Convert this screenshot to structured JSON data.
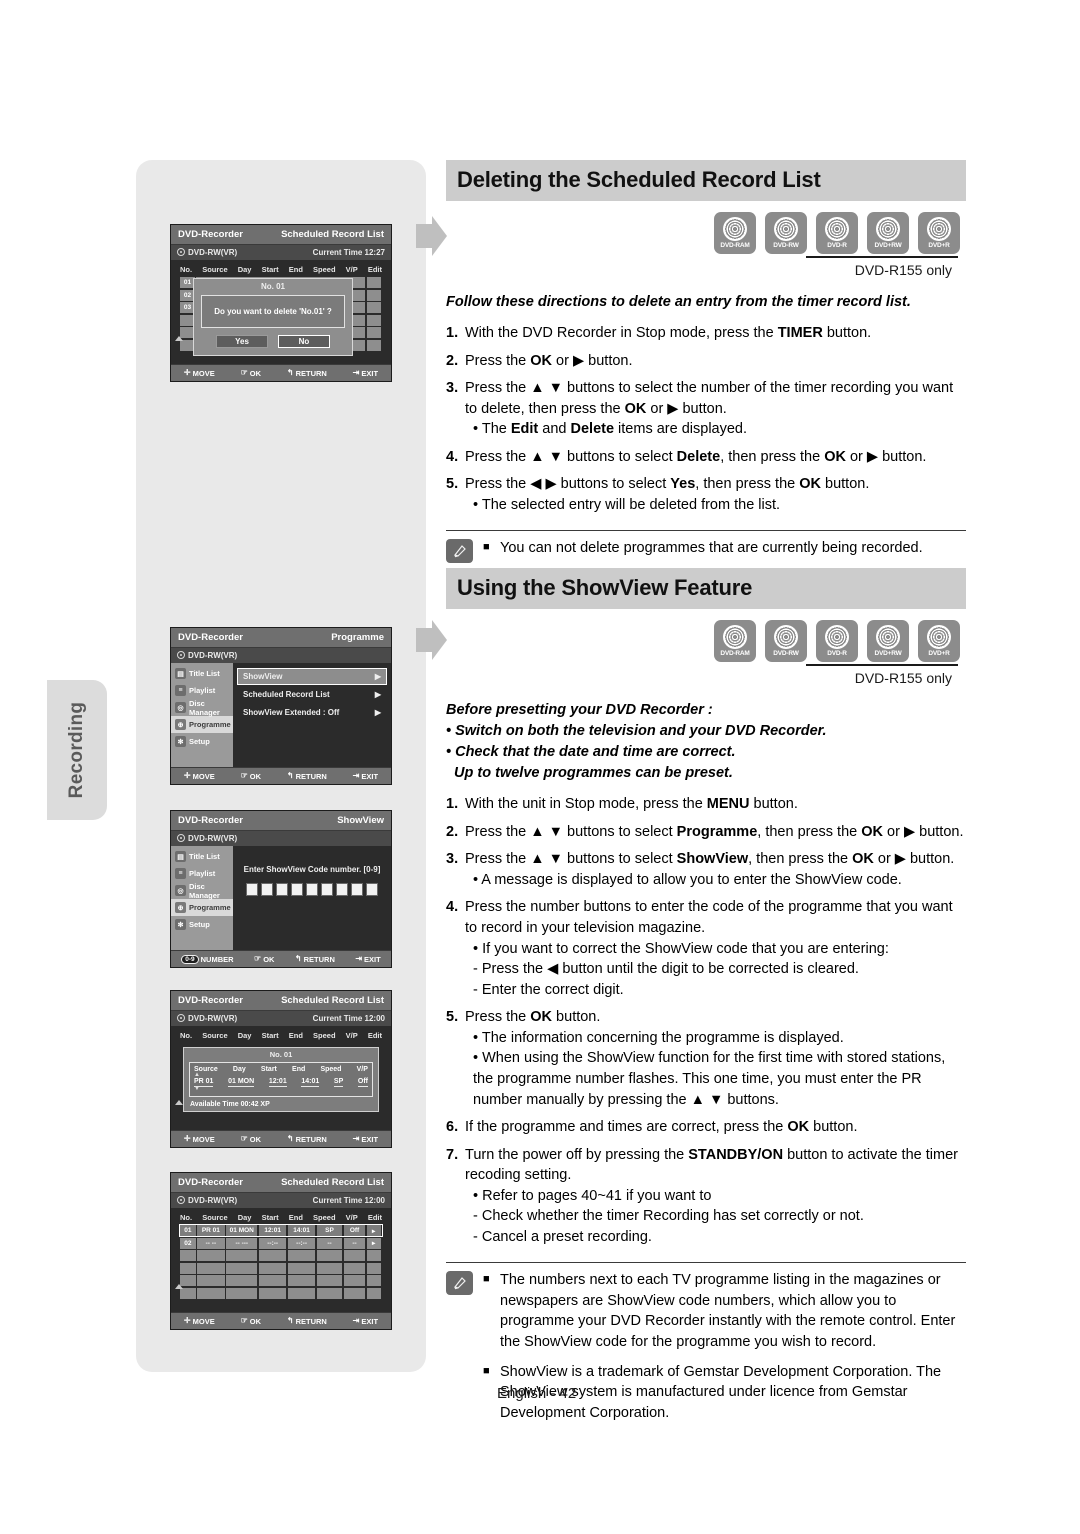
{
  "side_tab": {
    "label": "Recording"
  },
  "footer": {
    "page_label": "English - 42"
  },
  "sections": [
    {
      "heading": "Deleting the Scheduled Record List",
      "discs": [
        "DVD-RAM",
        "DVD-RW",
        "DVD-R",
        "DVD+RW",
        "DVD+R"
      ],
      "only_note": "DVD-R155 only",
      "lead": "Follow these directions to delete an entry from the timer record list.",
      "lead_sub": [],
      "steps": [
        {
          "num": "1.",
          "text": "With the DVD Recorder in Stop mode, press the <b>TIMER</b> button.",
          "sub": []
        },
        {
          "num": "2.",
          "text": "Press the <b>OK</b> or ▶ button.",
          "sub": []
        },
        {
          "num": "3.",
          "text": "Press the ▲ ▼ buttons to select the number of the timer recording you want to delete, then press the <b>OK</b> or ▶ button.",
          "sub": [
            "• The <b>Edit</b> and <b>Delete</b> items are displayed."
          ]
        },
        {
          "num": "4.",
          "text": "Press the ▲ ▼ buttons to select <b>Delete</b>, then press the <b>OK</b> or ▶ button.",
          "sub": []
        },
        {
          "num": "5.",
          "text": "Press the ◀ ▶ buttons to select <b>Yes</b>, then press the <b>OK</b> button.",
          "sub": [
            "• The selected entry will be deleted from the list."
          ]
        }
      ],
      "notes": [
        "You can not delete programmes that are currently being recorded."
      ]
    },
    {
      "heading": "Using the ShowView Feature",
      "discs": [
        "DVD-RAM",
        "DVD-RW",
        "DVD-R",
        "DVD+RW",
        "DVD+R"
      ],
      "only_note": "DVD-R155 only",
      "lead": "Before presetting your DVD Recorder :",
      "lead_sub": [
        "• Switch on both the television and your DVD Recorder.",
        "• Check that the date and time are correct.",
        "  Up to twelve programmes can be preset."
      ],
      "steps": [
        {
          "num": "1.",
          "text": "With the unit in Stop mode, press the <b>MENU</b> button.",
          "sub": []
        },
        {
          "num": "2.",
          "text": "Press the ▲ ▼ buttons to select <b>Programme</b>, then press the <b>OK</b> or ▶ button.",
          "sub": []
        },
        {
          "num": "3.",
          "text": "Press the ▲ ▼ buttons to select <b>ShowView</b>, then press the <b>OK</b> or ▶ button.",
          "sub": [
            "• A message is displayed to allow you to enter the ShowView code."
          ]
        },
        {
          "num": "4.",
          "text": "Press the number buttons to enter the code of the programme that you want to record in your television magazine.",
          "sub": [
            "• If you want to correct the ShowView code that you are entering:",
            "- Press the ◀ button until the digit to be corrected is cleared.",
            "- Enter the correct digit."
          ]
        },
        {
          "num": "5.",
          "text": "Press the <b>OK</b> button.",
          "sub": [
            "• The information concerning the programme is displayed.",
            "• When using the ShowView function for the first time with stored stations, the programme number flashes. This one time, you must enter the PR number manually by pressing the ▲ ▼ buttons."
          ]
        },
        {
          "num": "6.",
          "text": "If the programme and times are correct, press the <b>OK</b> button.",
          "sub": []
        },
        {
          "num": "7.",
          "text": "Turn the power off by pressing the <b>STANDBY/ON</b> button to activate the timer recoding setting.",
          "sub": [
            "• Refer to pages 40~41 if you want to",
            "- Check whether the timer Recording has set correctly or not.",
            "- Cancel a preset recording."
          ]
        }
      ],
      "notes": [
        "The numbers next to each TV programme listing in the magazines or newspapers are ShowView code numbers, which allow you to programme your DVD Recorder instantly with the remote control. Enter the ShowView code for the programme you wish to record.",
        "ShowView is a trademark of Gemstar Development Corporation. The ShowView system is manufactured under licence from Gemstar Development Corporation."
      ]
    }
  ],
  "screens": {
    "footer_hints": {
      "move": "MOVE",
      "ok": "OK",
      "return": "RETURN",
      "exit": "EXIT",
      "number": "NUMBER",
      "number_badge": "0-9"
    },
    "s1": {
      "title_left": "DVD-Recorder",
      "title_right": "Scheduled Record List",
      "disc_label": "DVD-RW(VR)",
      "time_label": "Current Time  12:27",
      "columns": [
        "No.",
        "Source",
        "Day",
        "Start",
        "End",
        "Speed",
        "V/P",
        "Edit"
      ],
      "rows": [
        "01",
        "02",
        "03"
      ],
      "dialog": {
        "header": "No. 01",
        "message": "Do you want to delete 'No.01' ?",
        "yes": "Yes",
        "no": "No"
      }
    },
    "s2": {
      "title_left": "DVD-Recorder",
      "title_right": "Programme",
      "disc_label": "DVD-RW(VR)",
      "sidebar": [
        "Title List",
        "Playlist",
        "Disc Manager",
        "Programme",
        "Setup"
      ],
      "sidebar_active": "Programme",
      "items": [
        "ShowView",
        "Scheduled Record List",
        "ShowView Extended : Off"
      ],
      "item_selected": "ShowView"
    },
    "s3": {
      "title_left": "DVD-Recorder",
      "title_right": "ShowView",
      "disc_label": "DVD-RW(VR)",
      "sidebar": [
        "Title List",
        "Playlist",
        "Disc Manager",
        "Programme",
        "Setup"
      ],
      "sidebar_active": "Programme",
      "prompt": "Enter ShowView Code number. [0-9]",
      "digit_count": 9
    },
    "s4": {
      "title_left": "DVD-Recorder",
      "title_right": "Scheduled Record List",
      "disc_label": "DVD-RW(VR)",
      "time_label": "Current Time  12:00",
      "columns": [
        "No.",
        "Source",
        "Day",
        "Start",
        "End",
        "Speed",
        "V/P",
        "Edit"
      ],
      "detail_header": "No. 01",
      "detail_columns": [
        "Source",
        "Day",
        "Start",
        "End",
        "Speed",
        "V/P"
      ],
      "detail_values": [
        "PR 01",
        "01 MON",
        "12:01",
        "14:01",
        "SP",
        "Off"
      ],
      "available": "Available Time   00:42   XP"
    },
    "s5": {
      "title_left": "DVD-Recorder",
      "title_right": "Scheduled Record List",
      "disc_label": "DVD-RW(VR)",
      "time_label": "Current Time  12:00",
      "columns": [
        "No.",
        "Source",
        "Day",
        "Start",
        "End",
        "Speed",
        "V/P",
        "Edit"
      ],
      "row1": [
        "01",
        "PR 01",
        "01 MON",
        "12:01",
        "14:01",
        "SP",
        "Off",
        "▸"
      ],
      "row2": [
        "02",
        "-- --",
        "-- ---",
        "--:--",
        "--:--",
        "--",
        "--",
        "▸"
      ],
      "empty_rows": 4
    }
  }
}
